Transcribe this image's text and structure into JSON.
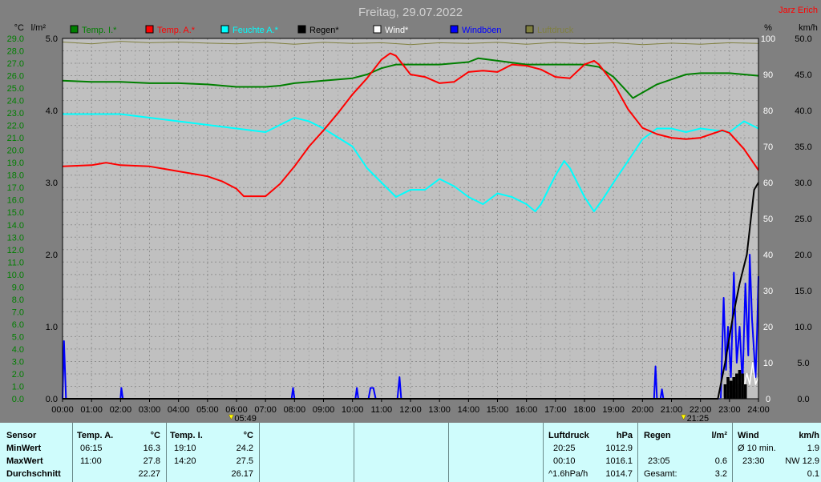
{
  "header": {
    "title": "Freitag, 29.07.2022",
    "author": "Jarz Erich"
  },
  "legend": [
    {
      "label": "Temp. I.*",
      "color": "#007f00"
    },
    {
      "label": "Temp. A.*",
      "color": "#ff0000"
    },
    {
      "label": "Feuchte A.*",
      "color": "#00ffff"
    },
    {
      "label": "Regen*",
      "color": "#000000"
    },
    {
      "label": "Wind*",
      "color": "#ffffff"
    },
    {
      "label": "Windböen",
      "color": "#0000ff"
    },
    {
      "label": "Luftdruck",
      "color": "#7f7f3f"
    }
  ],
  "axis_units": {
    "temp": "°C",
    "rain": "l/m²",
    "humidity": "%",
    "wind": "km/h"
  },
  "markers": {
    "sunrise": "05:49",
    "sunset": "21:25"
  },
  "chart_data": {
    "type": "line",
    "x_label_ticks": [
      "00:00",
      "01:00",
      "02:00",
      "03:00",
      "04:00",
      "05:00",
      "06:00",
      "07:00",
      "08:00",
      "09:00",
      "10:00",
      "11:00",
      "12:00",
      "13:00",
      "14:00",
      "15:00",
      "16:00",
      "17:00",
      "18:00",
      "19:00",
      "20:00",
      "21:00",
      "22:00",
      "23:00",
      "24:00"
    ],
    "x_range_hours": [
      0,
      24
    ],
    "temp_axis": {
      "range": [
        0,
        29
      ],
      "ticks": [
        "0.0",
        "1.0",
        "2.0",
        "3.0",
        "4.0",
        "5.0",
        "6.0",
        "7.0",
        "8.0",
        "9.0",
        "10.0",
        "11.0",
        "12.0",
        "13.0",
        "14.0",
        "15.0",
        "16.0",
        "17.0",
        "18.0",
        "19.0",
        "20.0",
        "21.0",
        "22.0",
        "23.0",
        "24.0",
        "25.0",
        "26.0",
        "27.0",
        "28.0",
        "29.0"
      ]
    },
    "rain_axis": {
      "range": [
        0,
        5
      ],
      "ticks": [
        "0.0",
        "1.0",
        "2.0",
        "3.0",
        "4.0",
        "5.0"
      ]
    },
    "humidity_axis": {
      "range": [
        0,
        100
      ],
      "ticks": [
        "0",
        "10",
        "20",
        "30",
        "40",
        "50",
        "60",
        "70",
        "80",
        "90",
        "100"
      ]
    },
    "wind_axis": {
      "range": [
        0,
        50
      ],
      "ticks": [
        "0.0",
        "5.0",
        "10.0",
        "15.0",
        "20.0",
        "25.0",
        "30.0",
        "35.0",
        "40.0",
        "45.0",
        "50.0"
      ]
    },
    "series": [
      {
        "name": "Temp. I.*",
        "axis": "temp",
        "color": "#007f00",
        "points": [
          [
            0,
            25.6
          ],
          [
            1,
            25.5
          ],
          [
            2,
            25.5
          ],
          [
            3,
            25.4
          ],
          [
            4,
            25.4
          ],
          [
            5,
            25.3
          ],
          [
            6,
            25.1
          ],
          [
            7,
            25.1
          ],
          [
            7.5,
            25.2
          ],
          [
            8,
            25.4
          ],
          [
            9,
            25.6
          ],
          [
            10,
            25.8
          ],
          [
            10.5,
            26.1
          ],
          [
            11,
            26.6
          ],
          [
            11.5,
            26.9
          ],
          [
            12,
            26.9
          ],
          [
            13,
            26.9
          ],
          [
            14,
            27.1
          ],
          [
            14.33,
            27.4
          ],
          [
            15,
            27.2
          ],
          [
            16,
            26.9
          ],
          [
            17,
            26.9
          ],
          [
            18,
            26.9
          ],
          [
            18.5,
            26.7
          ],
          [
            19,
            25.9
          ],
          [
            19.4,
            24.9
          ],
          [
            19.67,
            24.2
          ],
          [
            19.9,
            24.5
          ],
          [
            20.5,
            25.3
          ],
          [
            21,
            25.7
          ],
          [
            21.5,
            26.1
          ],
          [
            22,
            26.2
          ],
          [
            23,
            26.2
          ],
          [
            24,
            26.0
          ]
        ]
      },
      {
        "name": "Temp. A.*",
        "axis": "temp",
        "color": "#ff0000",
        "points": [
          [
            0,
            18.7
          ],
          [
            1,
            18.8
          ],
          [
            1.5,
            19.0
          ],
          [
            2,
            18.8
          ],
          [
            3,
            18.7
          ],
          [
            3.5,
            18.5
          ],
          [
            4,
            18.3
          ],
          [
            5,
            17.9
          ],
          [
            5.5,
            17.5
          ],
          [
            6,
            16.9
          ],
          [
            6.25,
            16.3
          ],
          [
            7,
            16.3
          ],
          [
            7.5,
            17.3
          ],
          [
            8,
            18.7
          ],
          [
            8.5,
            20.3
          ],
          [
            9,
            21.6
          ],
          [
            9.5,
            23.0
          ],
          [
            10,
            24.5
          ],
          [
            10.5,
            25.8
          ],
          [
            11,
            27.3
          ],
          [
            11.3,
            27.8
          ],
          [
            11.5,
            27.6
          ],
          [
            12,
            26.1
          ],
          [
            12.5,
            25.9
          ],
          [
            13,
            25.4
          ],
          [
            13.5,
            25.5
          ],
          [
            14,
            26.3
          ],
          [
            14.5,
            26.4
          ],
          [
            15,
            26.3
          ],
          [
            15.5,
            26.9
          ],
          [
            16,
            26.8
          ],
          [
            16.5,
            26.5
          ],
          [
            17,
            25.9
          ],
          [
            17.5,
            25.8
          ],
          [
            18,
            26.9
          ],
          [
            18.33,
            27.2
          ],
          [
            18.5,
            26.9
          ],
          [
            19,
            25.4
          ],
          [
            19.5,
            23.3
          ],
          [
            20,
            21.8
          ],
          [
            20.5,
            21.3
          ],
          [
            21,
            21.0
          ],
          [
            21.5,
            20.9
          ],
          [
            22,
            21.0
          ],
          [
            22.5,
            21.4
          ],
          [
            22.75,
            21.6
          ],
          [
            23,
            21.4
          ],
          [
            23.5,
            20.1
          ],
          [
            24,
            18.4
          ]
        ]
      },
      {
        "name": "Feuchte A.*",
        "axis": "humidity",
        "color": "#00ffff",
        "points": [
          [
            0,
            79
          ],
          [
            1,
            79
          ],
          [
            2,
            79
          ],
          [
            3,
            78
          ],
          [
            4,
            77
          ],
          [
            5,
            76
          ],
          [
            6,
            75
          ],
          [
            7,
            74
          ],
          [
            7.5,
            76
          ],
          [
            8,
            78
          ],
          [
            8.5,
            77
          ],
          [
            9,
            75
          ],
          [
            10,
            70
          ],
          [
            10.5,
            64
          ],
          [
            11,
            60
          ],
          [
            11.5,
            56
          ],
          [
            12,
            58
          ],
          [
            12.5,
            58
          ],
          [
            13,
            61
          ],
          [
            13.5,
            59
          ],
          [
            14,
            56
          ],
          [
            14.5,
            54
          ],
          [
            15,
            57
          ],
          [
            15.5,
            56
          ],
          [
            16,
            54
          ],
          [
            16.3,
            52
          ],
          [
            16.5,
            54
          ],
          [
            17,
            62
          ],
          [
            17.3,
            66
          ],
          [
            17.5,
            64
          ],
          [
            18,
            56
          ],
          [
            18.33,
            52
          ],
          [
            18.6,
            55
          ],
          [
            19,
            60
          ],
          [
            19.5,
            66
          ],
          [
            20,
            72
          ],
          [
            20.5,
            75
          ],
          [
            21,
            75
          ],
          [
            21.5,
            74
          ],
          [
            22,
            75
          ],
          [
            23,
            74
          ],
          [
            23.5,
            77
          ],
          [
            24,
            75
          ]
        ]
      },
      {
        "name": "Regen*",
        "axis": "rain",
        "color": "#000000",
        "points": [
          [
            0,
            0
          ],
          [
            22.6,
            0
          ],
          [
            22.85,
            0.5
          ],
          [
            23.1,
            1.1
          ],
          [
            23.35,
            1.6
          ],
          [
            23.6,
            2.0
          ],
          [
            23.85,
            2.9
          ],
          [
            24,
            3.0
          ]
        ]
      },
      {
        "name": "Windböen",
        "axis": "wind",
        "color": "#0000ff",
        "points": [
          [
            0,
            0
          ],
          [
            0.05,
            8
          ],
          [
            0.12,
            0
          ],
          [
            2,
            0
          ],
          [
            2.03,
            1.5
          ],
          [
            2.08,
            0
          ],
          [
            7.9,
            0
          ],
          [
            7.95,
            1.5
          ],
          [
            8.0,
            0
          ],
          [
            10.1,
            0
          ],
          [
            10.15,
            1.5
          ],
          [
            10.2,
            0
          ],
          [
            10.55,
            0
          ],
          [
            10.62,
            1.5
          ],
          [
            10.72,
            1.5
          ],
          [
            10.8,
            0
          ],
          [
            11.55,
            0
          ],
          [
            11.62,
            3
          ],
          [
            11.68,
            0
          ],
          [
            20.4,
            0
          ],
          [
            20.45,
            4.5
          ],
          [
            20.5,
            0
          ],
          [
            20.62,
            0
          ],
          [
            20.67,
            1.3
          ],
          [
            20.72,
            0
          ],
          [
            22.7,
            0
          ],
          [
            22.8,
            14
          ],
          [
            22.88,
            4
          ],
          [
            22.95,
            10
          ],
          [
            23.05,
            3
          ],
          [
            23.15,
            17.5
          ],
          [
            23.25,
            5
          ],
          [
            23.35,
            10
          ],
          [
            23.45,
            2
          ],
          [
            23.55,
            16
          ],
          [
            23.65,
            6
          ],
          [
            23.7,
            20
          ],
          [
            23.78,
            11
          ],
          [
            23.9,
            3
          ],
          [
            23.95,
            9
          ],
          [
            24,
            17
          ]
        ]
      },
      {
        "name": "Wind*",
        "axis": "wind",
        "color": "#ffffff",
        "points": [
          [
            0,
            0
          ],
          [
            22.8,
            0
          ],
          [
            22.9,
            1.5
          ],
          [
            23.0,
            0.5
          ],
          [
            23.1,
            2.5
          ],
          [
            23.2,
            1
          ],
          [
            23.35,
            3
          ],
          [
            23.5,
            1.5
          ],
          [
            23.6,
            3.5
          ],
          [
            23.7,
            2
          ],
          [
            23.8,
            5
          ],
          [
            23.9,
            2
          ],
          [
            24,
            3
          ]
        ]
      },
      {
        "name": "Luftdruck",
        "axis": "humidity",
        "color": "#7f7f3f",
        "points": [
          [
            0,
            99
          ],
          [
            1,
            98.5
          ],
          [
            2,
            99.2
          ],
          [
            3,
            98.8
          ],
          [
            4,
            99
          ],
          [
            5,
            98.7
          ],
          [
            6,
            98.5
          ],
          [
            7,
            98.9
          ],
          [
            8,
            98.4
          ],
          [
            9,
            98.9
          ],
          [
            10,
            98.6
          ],
          [
            11,
            98.8
          ],
          [
            12,
            98.3
          ],
          [
            13,
            98.8
          ],
          [
            14,
            98.6
          ],
          [
            15,
            98.9
          ],
          [
            16,
            98.4
          ],
          [
            17,
            98.9
          ],
          [
            18,
            98.5
          ],
          [
            19,
            98.8
          ],
          [
            20,
            98.3
          ],
          [
            21,
            98.7
          ],
          [
            22,
            98.4
          ],
          [
            23,
            98.8
          ],
          [
            24,
            98.6
          ]
        ]
      }
    ],
    "rain_bars": {
      "axis": "rain",
      "color": "#000000",
      "bars": [
        [
          22.8,
          0.2
        ],
        [
          22.9,
          0.3
        ],
        [
          23.0,
          0.25
        ],
        [
          23.1,
          0.3
        ],
        [
          23.2,
          0.35
        ],
        [
          23.3,
          0.4
        ],
        [
          23.4,
          0.35
        ],
        [
          23.5,
          0.2
        ]
      ]
    }
  },
  "stats": {
    "sensor_header": "Sensor",
    "row_labels": [
      "MinWert",
      "MaxWert",
      "Durchschnitt"
    ],
    "temp_a": {
      "title": "Temp. A.",
      "unit": "°C",
      "rows": [
        [
          "06:15",
          "16.3"
        ],
        [
          "11:00",
          "27.8"
        ],
        [
          "",
          "22.27"
        ]
      ]
    },
    "temp_i": {
      "title": "Temp. I.",
      "unit": "°C",
      "rows": [
        [
          "19:10",
          "24.2"
        ],
        [
          "14:20",
          "27.5"
        ],
        [
          "",
          "26.17"
        ]
      ]
    },
    "pressure": {
      "title": "Luftdruck",
      "unit": "hPa",
      "rows": [
        [
          "20:25",
          "1012.9"
        ],
        [
          "00:10",
          "1016.1"
        ],
        [
          "^1.6hPa/h",
          "1014.7"
        ]
      ]
    },
    "rain": {
      "title": "Regen",
      "unit": "l/m²",
      "rows": [
        [
          "",
          ""
        ],
        [
          "23:05",
          "0.6"
        ],
        [
          "Gesamt:",
          "3.2"
        ]
      ]
    },
    "wind": {
      "title": "Wind",
      "unit": "km/h",
      "rows": [
        [
          "Ø 10 min.",
          "1.9"
        ],
        [
          "23:30",
          "NW 12.9"
        ],
        [
          "",
          "0.1"
        ]
      ]
    }
  }
}
